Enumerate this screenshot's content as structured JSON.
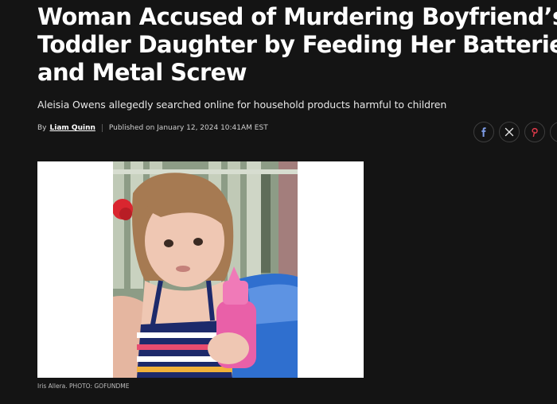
{
  "article": {
    "headline_lines": [
      "Woman Accused of Murdering Boyfriend’s",
      "Toddler Daughter by Feeding Her Batteries",
      "and Metal Screw"
    ],
    "dek": "Aleisia Owens allegedly searched online for household products harmful to children",
    "byline": {
      "prefix": "By",
      "author": "Liam Quinn",
      "published": "Published on January 12, 2024 10:41AM EST"
    },
    "share": {
      "icons": [
        "facebook-icon",
        "x-twitter-icon",
        "pinterest-icon",
        "more-share-icon"
      ]
    },
    "photo": {
      "caption": "Iris Allera. PHOTO: GOFUNDME"
    }
  },
  "colors": {
    "background": "#141414",
    "text": "#ffffff",
    "frame": "#ffffff",
    "facebook": "#3b5998",
    "pinterest": "#e60023"
  }
}
